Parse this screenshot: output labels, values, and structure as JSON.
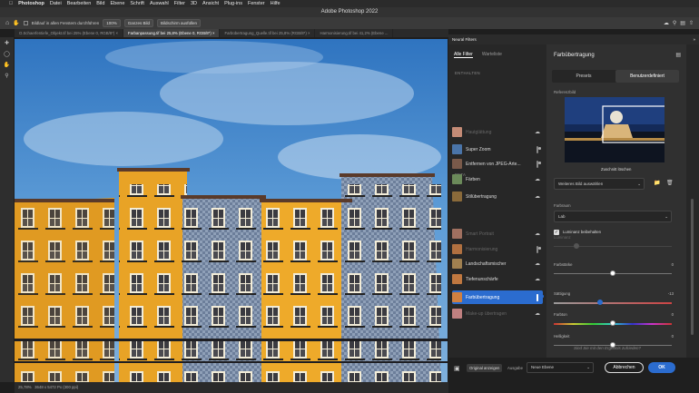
{
  "menubar": {
    "apple": "",
    "items": [
      "Photoshop",
      "Datei",
      "Bearbeiten",
      "Bild",
      "Ebene",
      "Schrift",
      "Auswahl",
      "Filter",
      "3D",
      "Ansicht",
      "Plug-ins",
      "Fenster",
      "Hilfe"
    ]
  },
  "window": {
    "title": "Adobe Photoshop 2022"
  },
  "options": {
    "checkbox_label": "Bildlauf in allen Fenstern durchführen",
    "zoom": "100%",
    "fit_screen": "Ganzes Bild",
    "fill_screen": "Bildschirm ausfüllen"
  },
  "tabs": [
    "O.Schaerfentiefe_Objekt.tif bei 25% (Ebene 0, RGB/8*) ×",
    "Farbanpassung.tif bei 25,8% (Ebene 0, RGB/8*) ×",
    "Farbübertragung_Quelle.tif bei 25,8% (RGB/8*) ×",
    "Harmonisierung.tif bei 41,2% (Ebene ..."
  ],
  "status": {
    "zoom": "25,78%",
    "doc": "3648 x 5472 Px (300 ppi)"
  },
  "panel": {
    "title": "Neural Filters",
    "tab_all": "Alle Filter",
    "tab_wait": "Warteliste"
  },
  "sections": {
    "included": "ENTHALTEN",
    "beta": "BETA"
  },
  "filters": [
    {
      "name": "Hautglättung",
      "status": "cloud",
      "dim": true,
      "color": "#c48b76"
    },
    {
      "name": "Super Zoom",
      "status": "toggle",
      "dim": false,
      "color": "#4a74a8"
    },
    {
      "name": "Entfernen von JPEG-Arte...",
      "status": "toggle",
      "dim": false,
      "color": "#7a5a4a"
    },
    {
      "name": "Färben",
      "status": "cloud",
      "dim": false,
      "color": "#6b8a5a"
    },
    {
      "name": "Stilübertragung",
      "status": "cloud",
      "dim": false,
      "color": "#8a6a3a"
    },
    {
      "name": "Smart Portrait",
      "status": "cloud",
      "dim": true,
      "color": "#a07060"
    },
    {
      "name": "Harmonisierung",
      "status": "toggle",
      "dim": true,
      "color": "#b07040"
    },
    {
      "name": "Landschaftsmischer",
      "status": "cloud",
      "dim": false,
      "color": "#a08050"
    },
    {
      "name": "Tiefenunschärfe",
      "status": "cloud",
      "dim": false,
      "color": "#c07840"
    },
    {
      "name": "Farbübertragung",
      "status": "toggle-on",
      "dim": false,
      "color": "#d08040"
    },
    {
      "name": "Make-up übertragen",
      "status": "cloud",
      "dim": true,
      "color": "#c08080"
    }
  ],
  "settings": {
    "title": "Farbübertragung",
    "tab_presets": "Presets",
    "tab_custom": "Benutzerdefiniert",
    "ref_label": "Referenzbild",
    "zoom_label": "Zuschnitt löschen",
    "select_image": "Weiteres Bild auswählen",
    "colorspace_label": "Farbraum",
    "colorspace_value": "Lab",
    "luminance_label": "Luminanz beibehalten",
    "luminance_checked": true,
    "sliders": [
      {
        "name": "Luminanz",
        "value": "",
        "dim": true,
        "level": 0.0
      },
      {
        "name": "Farbstärke",
        "value": "0",
        "dim": false,
        "level": 0.5
      },
      {
        "name": "Sättigung",
        "value": "-13",
        "dim": false,
        "level": 0.39
      },
      {
        "name": "Farbton",
        "value": "0",
        "dim": false,
        "level": 0.5
      },
      {
        "name": "Helligkeit",
        "value": "0",
        "dim": false,
        "level": 0.5
      }
    ],
    "feedback": "Sind Sie mit den Ergebnis zufrieden?"
  },
  "footer": {
    "show_original": "Original anzeigen",
    "output_label": "Ausgabe",
    "output_value": "Neue Ebene",
    "cancel": "Abbrechen",
    "ok": "OK"
  },
  "colors": {
    "accent": "#2b6ccf",
    "panel": "#303030",
    "sky": "#3f86c8",
    "building_orange": "#e8a326"
  }
}
